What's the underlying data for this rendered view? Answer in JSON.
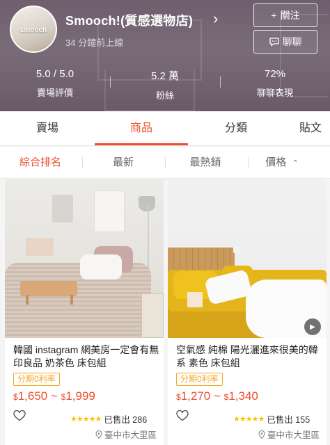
{
  "shop": {
    "avatar_text": "smooch",
    "name": "Smooch!(質感選物店)",
    "last_seen": "34 分鐘前上線",
    "follow_label": "關注",
    "chat_label": "聊聊",
    "stats": [
      {
        "value": "5.0 / 5.0",
        "label": "賣場評價"
      },
      {
        "value": "5.2 萬",
        "label": "粉絲"
      },
      {
        "value": "72%",
        "label": "聊聊表現"
      }
    ]
  },
  "tabs": [
    "賣場",
    "商品",
    "分類",
    "貼文"
  ],
  "active_tab": "商品",
  "sort": [
    "綜合排名",
    "最新",
    "最熱銷",
    "價格"
  ],
  "active_sort": "綜合排名",
  "products": [
    {
      "title": "韓國 instagram 網美房一定會有無印良品 奶茶色 床包組",
      "badge": "分期0利率",
      "price_low": "1,650",
      "price_high": "1,999",
      "currency": "$",
      "separator": "~",
      "rating": 5,
      "sold_label": "已售出 286",
      "location": "臺中市大里區"
    },
    {
      "title": "空氣感 純棉 陽光灑進來很美的韓系 素色 床包組",
      "badge": "分期0利率",
      "price_low": "1,270",
      "price_high": "1,340",
      "currency": "$",
      "separator": "~",
      "rating": 5,
      "sold_label": "已售出 155",
      "location": "臺中市大里區",
      "has_video": true
    }
  ],
  "colors": {
    "accent": "#ee4d2d",
    "badge": "#f5a623",
    "star": "#ffbf00",
    "header": "#6f5f6e"
  }
}
